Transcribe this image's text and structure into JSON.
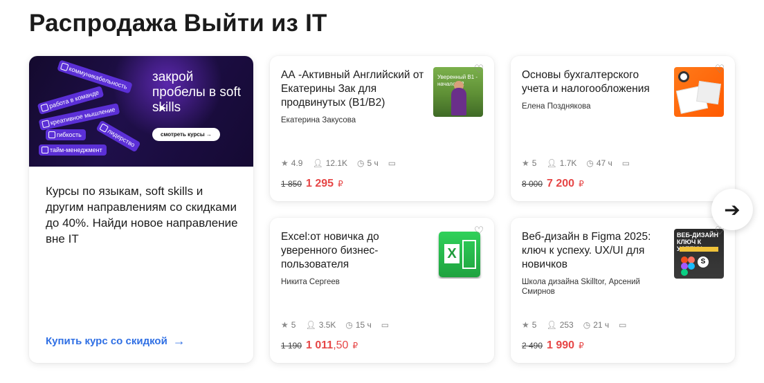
{
  "page": {
    "title": "Распродажа Выйти из IT"
  },
  "promo": {
    "banner": {
      "headline": "закрой пробелы в soft skills",
      "button": "смотреть курсы →",
      "chips": [
        "коммуникабельность",
        "работа в команде",
        "креативное мышление",
        "гибкость",
        "лидерство",
        "тайм-менеджмент"
      ]
    },
    "text": "Курсы по языкам, soft skills и другим направлениям со скидками до 40%. Найди новое направление вне IT",
    "link": "Купить курс со скидкой"
  },
  "courses": [
    {
      "title": "АА -Активный Английский от Екатерины Зак для продвинутых (B1/B2)",
      "author": "Екатерина Закусова",
      "thumb_text": "Уверенный B1 - начало B2",
      "rating": "4.9",
      "students": "12.1K",
      "hours": "5 ч",
      "old_price": "1 850",
      "price": "1 295",
      "price_kop": "",
      "currency": "₽"
    },
    {
      "title": "Основы бухгалтерского учета и налогообложения",
      "author": "Елена Позднякова",
      "rating": "5",
      "students": "1.7K",
      "hours": "47 ч",
      "old_price": "8 000",
      "price": "7 200",
      "price_kop": "",
      "currency": "₽"
    },
    {
      "title": "Excel:от новичка до уверенного бизнес-пользователя",
      "author": "Никита Сергеев",
      "rating": "5",
      "students": "3.5K",
      "hours": "15 ч",
      "old_price": "1 190",
      "price": "1 011",
      "price_kop": ",50",
      "currency": "₽"
    },
    {
      "title": "Веб-дизайн в Figma 2025: ключ к успеху. UX/UI для новичков",
      "author": "Школа дизайна Skilltor, Арсений Смирнов",
      "thumb_text": "ВЕБ-ДИЗАЙН КЛЮЧ К УСПЕХУ",
      "rating": "5",
      "students": "253",
      "hours": "21 ч",
      "old_price": "2 490",
      "price": "1 990",
      "price_kop": "",
      "currency": "₽"
    }
  ],
  "icons": {
    "star": "star-icon",
    "user": "user-icon",
    "clock": "clock-icon",
    "certificate": "certificate-icon",
    "heart": "heart-icon",
    "next": "arrow-right-icon"
  },
  "colors": {
    "price": "#e64646",
    "link": "#2f6fe4",
    "banner": "#1f0f4a"
  }
}
